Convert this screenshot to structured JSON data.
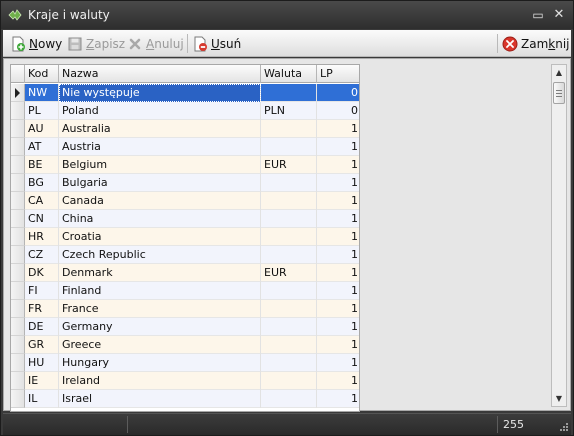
{
  "window": {
    "title": "Kraje i waluty",
    "minimize_glyph": "▭",
    "close_glyph": "✕"
  },
  "toolbar": {
    "new_prefix": "N",
    "new_rest": "owy",
    "save_prefix": "Z",
    "save_rest": "apisz",
    "cancel_prefix": "A",
    "cancel_rest": "nuluj",
    "delete_prefix": "U",
    "delete_rest": "suń",
    "close_pre": "Zam",
    "close_u": "k",
    "close_post": "nij"
  },
  "grid": {
    "columns": [
      "Kod",
      "Nazwa",
      "Waluta",
      "LP"
    ],
    "rows": [
      {
        "kod": "NW",
        "nazwa": "Nie występuje",
        "waluta": "",
        "lp": "0"
      },
      {
        "kod": "PL",
        "nazwa": "Poland",
        "waluta": "PLN",
        "lp": "0"
      },
      {
        "kod": "AU",
        "nazwa": "Australia",
        "waluta": "",
        "lp": "1"
      },
      {
        "kod": "AT",
        "nazwa": "Austria",
        "waluta": "",
        "lp": "1"
      },
      {
        "kod": "BE",
        "nazwa": "Belgium",
        "waluta": "EUR",
        "lp": "1"
      },
      {
        "kod": "BG",
        "nazwa": "Bulgaria",
        "waluta": "",
        "lp": "1"
      },
      {
        "kod": "CA",
        "nazwa": "Canada",
        "waluta": "",
        "lp": "1"
      },
      {
        "kod": "CN",
        "nazwa": "China",
        "waluta": "",
        "lp": "1"
      },
      {
        "kod": "HR",
        "nazwa": "Croatia",
        "waluta": "",
        "lp": "1"
      },
      {
        "kod": "CZ",
        "nazwa": "Czech Republic",
        "waluta": "",
        "lp": "1"
      },
      {
        "kod": "DK",
        "nazwa": "Denmark",
        "waluta": "EUR",
        "lp": "1"
      },
      {
        "kod": "FI",
        "nazwa": "Finland",
        "waluta": "",
        "lp": "1"
      },
      {
        "kod": "FR",
        "nazwa": "France",
        "waluta": "",
        "lp": "1"
      },
      {
        "kod": "DE",
        "nazwa": "Germany",
        "waluta": "",
        "lp": "1"
      },
      {
        "kod": "GR",
        "nazwa": "Greece",
        "waluta": "",
        "lp": "1"
      },
      {
        "kod": "HU",
        "nazwa": "Hungary",
        "waluta": "",
        "lp": "1"
      },
      {
        "kod": "IE",
        "nazwa": "Ireland",
        "waluta": "",
        "lp": "1"
      },
      {
        "kod": "IL",
        "nazwa": "Israel",
        "waluta": "",
        "lp": "1"
      }
    ],
    "selected_index": 0
  },
  "statusbar": {
    "record_count": "255"
  },
  "colors": {
    "selection": "#2f6fd6",
    "row_odd": "#f2f4fc",
    "row_even": "#fdf6ea",
    "titlebar": "#3a3a3a"
  },
  "icons": {
    "app": "app-logo-icon",
    "new": "new-document-icon",
    "save": "save-disk-icon",
    "cancel": "cancel-x-icon",
    "delete": "delete-document-icon",
    "close": "close-circle-icon"
  }
}
